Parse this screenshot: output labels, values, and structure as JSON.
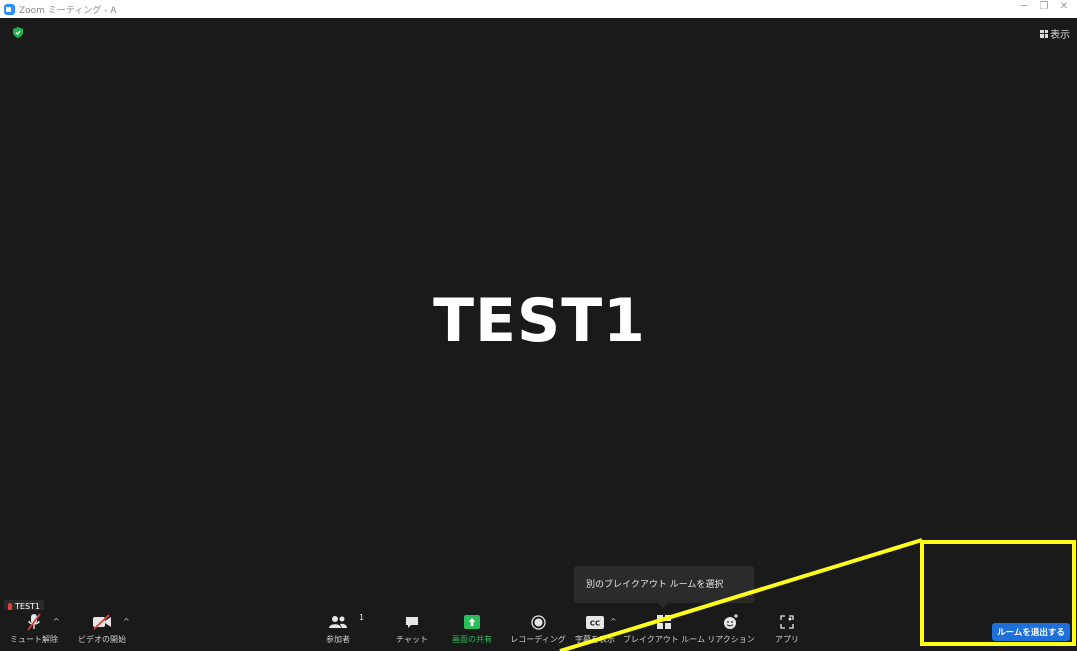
{
  "window": {
    "title": "Zoom ミーティング - A"
  },
  "header": {
    "view_label": "表示"
  },
  "stage": {
    "speaker_name": "TEST1"
  },
  "self_view": {
    "name": "TEST1"
  },
  "tooltip": {
    "text": "別のブレイクアウト ルームを選択"
  },
  "toolbar": {
    "mute": "ミュート解除",
    "video": "ビデオの開始",
    "participants": "参加者",
    "participants_count": "1",
    "chat": "チャット",
    "share": "画面の共有",
    "record": "レコーディング",
    "captions": "字幕を表示",
    "breakout": "ブレイクアウト ルーム",
    "reactions": "リアクション",
    "apps": "アプリ",
    "leave_room": "ルームを退出する"
  },
  "icons": {
    "security": "shield-icon",
    "view": "grid-icon",
    "mute": "mic-off-icon",
    "video": "video-off-icon",
    "participants": "participants-icon",
    "chat": "chat-icon",
    "share": "share-screen-icon",
    "record": "record-icon",
    "captions": "cc-icon",
    "breakout": "breakout-icon",
    "reactions": "reaction-icon",
    "apps": "apps-icon"
  },
  "colors": {
    "background": "#1a1a1a",
    "share_green": "#2bbf5a",
    "mute_red": "#e0403a",
    "leave_blue": "#1f6fdb",
    "annotation_yellow": "#ffff1a",
    "security_green": "#23b14d"
  }
}
